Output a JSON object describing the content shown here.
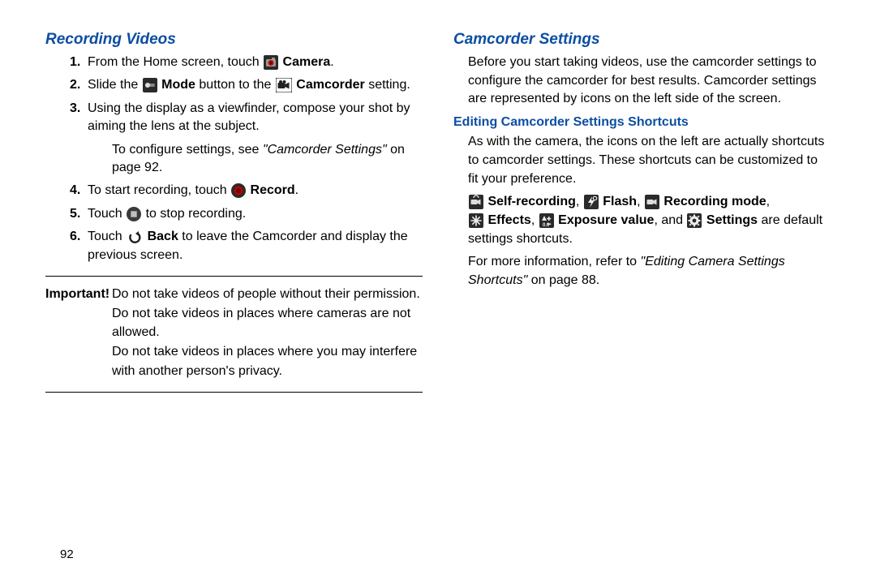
{
  "left": {
    "heading": "Recording Videos",
    "steps": [
      {
        "n": "1.",
        "pre": "From the Home screen, touch ",
        "icon": "camera",
        "bold": " Camera",
        "post": "."
      },
      {
        "n": "2.",
        "pre": "Slide the ",
        "icon": "mode",
        "bold": " Mode",
        "mid": " button to the ",
        "icon2": "camcorder",
        "bold2": " Camcorder",
        "post": " setting."
      },
      {
        "n": "3.",
        "text": "Using the display as a viewfinder, compose your shot by aiming the lens at the subject."
      },
      {
        "sub": true,
        "pre": "To configure settings, see ",
        "ref": "\"Camcorder Settings\"",
        "post": " on page 92."
      },
      {
        "n": "4.",
        "pre": "To start recording, touch ",
        "icon": "record",
        "bold": " Record",
        "post": "."
      },
      {
        "n": "5.",
        "pre": "Touch ",
        "icon": "stop",
        "post": " to stop recording."
      },
      {
        "n": "6.",
        "pre": "Touch ",
        "icon": "back",
        "bold": " Back",
        "post": " to leave the Camcorder and display the previous screen."
      }
    ],
    "important_label": "Important!",
    "important_lines": [
      "Do not take videos of people without their permission.",
      "Do not take videos in places where cameras are not allowed.",
      "Do not take videos in places where you may interfere with another person's privacy."
    ]
  },
  "right": {
    "heading": "Camcorder Settings",
    "intro": "Before you start taking videos, use the camcorder settings to configure the camcorder for best results. Camcorder settings are represented by icons on the left side of the screen.",
    "subheading": "Editing Camcorder Settings Shortcuts",
    "para1": "As with the camera, the icons on the left are actually shortcuts to camcorder settings. These shortcuts can be customized to fit your preference.",
    "shortcuts": {
      "self": "Self-recording",
      "flash": "Flash",
      "recmode": "Recording mode",
      "effects": "Effects",
      "exposure": "Exposure value",
      "and": ", and ",
      "settings": "Settings",
      "tail": " are default settings shortcuts."
    },
    "refer_pre": "For more information, refer to ",
    "refer_ref": "\"Editing Camera Settings Shortcuts\"",
    "refer_post": "  on page 88."
  },
  "page_number": "92"
}
